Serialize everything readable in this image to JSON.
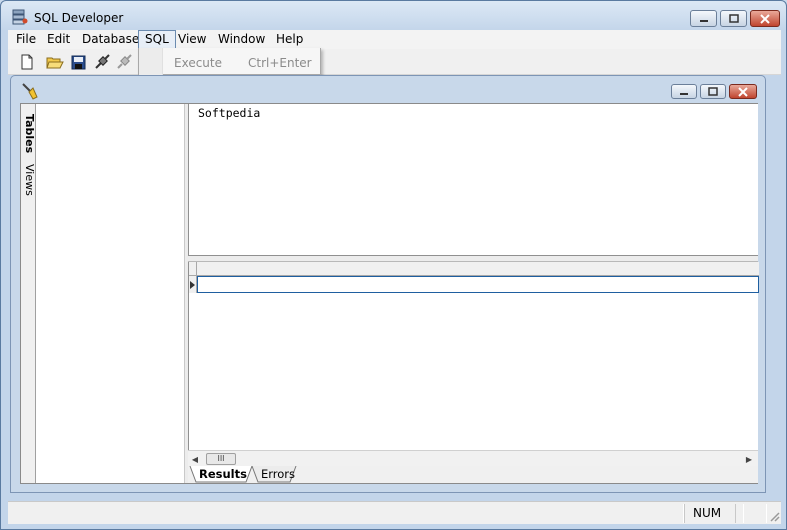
{
  "window": {
    "title": "SQL Developer"
  },
  "menu": {
    "items": [
      "File",
      "Edit",
      "Database",
      "SQL",
      "View",
      "Window",
      "Help"
    ],
    "active": "SQL"
  },
  "sql_menu": {
    "execute_label": "Execute",
    "execute_shortcut": "Ctrl+Enter"
  },
  "sidebar": {
    "tabs": [
      "Tables",
      "Views"
    ]
  },
  "editor": {
    "text": "Softpedia"
  },
  "results": {
    "tabs": [
      "Results",
      "Errors"
    ],
    "scroll_thumb": "III"
  },
  "status": {
    "num": "NUM"
  },
  "icons": [
    "new-file-icon",
    "open-folder-icon",
    "save-icon",
    "connect-icon",
    "disconnect-icon",
    "execute-broom-icon"
  ],
  "colors": {
    "close_button": "#c0452f",
    "selection_border": "#1f5fa0"
  }
}
